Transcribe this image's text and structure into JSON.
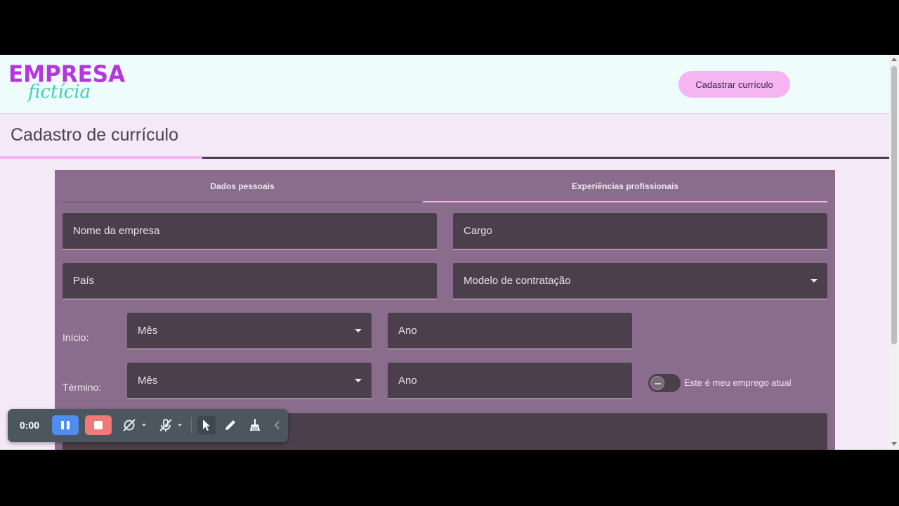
{
  "header": {
    "logo_top": "EMPRESA",
    "logo_bottom": "fictícia",
    "cta_label": "Cadastrar currículo"
  },
  "page": {
    "title": "Cadastro de currículo"
  },
  "tabs": [
    {
      "label": "Dados pessoais",
      "active": false
    },
    {
      "label": "Experiências profissionais",
      "active": true
    }
  ],
  "form": {
    "company_name": "Nome da empresa",
    "role": "Cargo",
    "country": "País",
    "contract_model": "Modelo de contratação",
    "start_label": "Início:",
    "start_month": "Mês",
    "start_year": "Ano",
    "end_label": "Término:",
    "end_month": "Mês",
    "end_year": "Ano",
    "current_job_label": "Este é meu emprego atual",
    "current_job_checked": false
  },
  "recorder": {
    "time": "0:00"
  },
  "colors": {
    "accent_pink": "#f5b4f2",
    "logo_purple": "#b536e0",
    "logo_teal": "#3ecfb8",
    "card_bg": "#8a6d8c",
    "field_bg": "#4b3f4b",
    "pause_blue": "#4f8ef0",
    "stop_red": "#ef7a78"
  }
}
